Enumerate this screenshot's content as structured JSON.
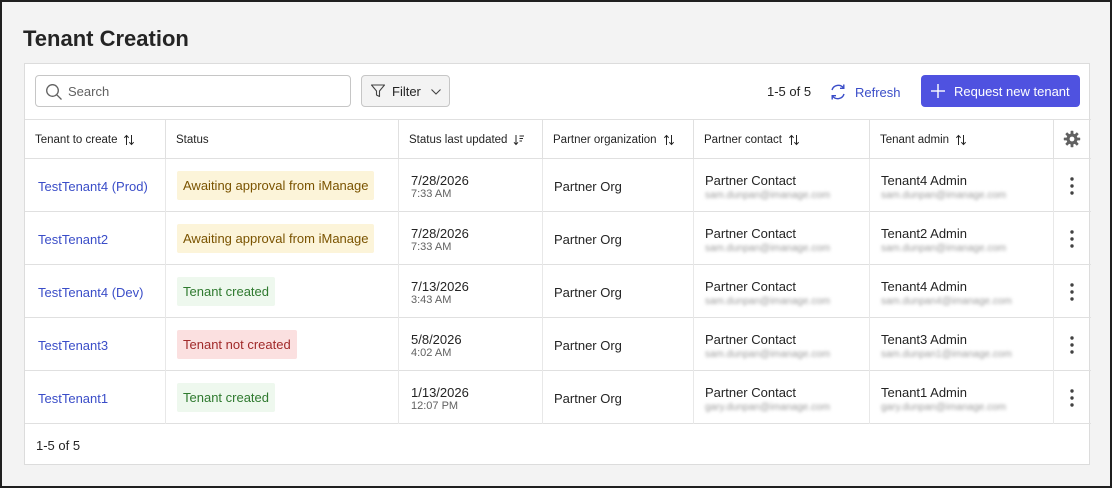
{
  "page": {
    "title": "Tenant Creation"
  },
  "toolbar": {
    "search_placeholder": "Search",
    "filter_label": "Filter",
    "count": "1-5 of 5",
    "refresh_label": "Refresh",
    "request_label": "Request new tenant"
  },
  "columns": [
    "Tenant to create",
    "Status",
    "Status last updated",
    "Partner organization",
    "Partner contact",
    "Tenant admin"
  ],
  "rows": [
    {
      "tenant": "TestTenant4 (Prod)",
      "status": "Awaiting approval from iManage",
      "status_kind": "warning",
      "date": "7/28/2026",
      "time": "7:33 AM",
      "org": "Partner Org",
      "contact": "Partner Contact",
      "contact_email": "sam.dunpan@imanage.com",
      "admin": "Tenant4 Admin",
      "admin_email": "sam.dunpan@imanage.com"
    },
    {
      "tenant": "TestTenant2",
      "status": "Awaiting approval from iManage",
      "status_kind": "warning",
      "date": "7/28/2026",
      "time": "7:33 AM",
      "org": "Partner Org",
      "contact": "Partner Contact",
      "contact_email": "sam.dunpan@imanage.com",
      "admin": "Tenant2 Admin",
      "admin_email": "sam.dunpan@imanage.com"
    },
    {
      "tenant": "TestTenant4 (Dev)",
      "status": "Tenant created",
      "status_kind": "success",
      "date": "7/13/2026",
      "time": "3:43 AM",
      "org": "Partner Org",
      "contact": "Partner Contact",
      "contact_email": "sam.dunpan@imanage.com",
      "admin": "Tenant4 Admin",
      "admin_email": "sam.dunpan4@imanage.com"
    },
    {
      "tenant": "TestTenant3",
      "status": "Tenant not created",
      "status_kind": "error",
      "date": "5/8/2026",
      "time": "4:02 AM",
      "org": "Partner Org",
      "contact": "Partner Contact",
      "contact_email": "sam.dunpan@imanage.com",
      "admin": "Tenant3 Admin",
      "admin_email": "sam.dunpan1@imanage.com"
    },
    {
      "tenant": "TestTenant1",
      "status": "Tenant created",
      "status_kind": "success",
      "date": "1/13/2026",
      "time": "12:07 PM",
      "org": "Partner Org",
      "contact": "Partner Contact",
      "contact_email": "gary.dunpan@imanage.com",
      "admin": "Tenant1 Admin",
      "admin_email": "gary.dunpan@imanage.com"
    }
  ],
  "footer": {
    "count": "1-5 of 5"
  },
  "colors": {
    "accent": "#4f52e0",
    "link": "#3a4dc8",
    "warning_bg": "#fcf4d9",
    "success_bg": "#eef8ee",
    "error_bg": "#fbe0e0"
  },
  "icons": [
    "search-icon",
    "filter-icon",
    "chevron-down-icon",
    "refresh-icon",
    "plus-icon",
    "sort-icon",
    "sort-desc-icon",
    "gear-icon",
    "more-vertical-icon"
  ]
}
